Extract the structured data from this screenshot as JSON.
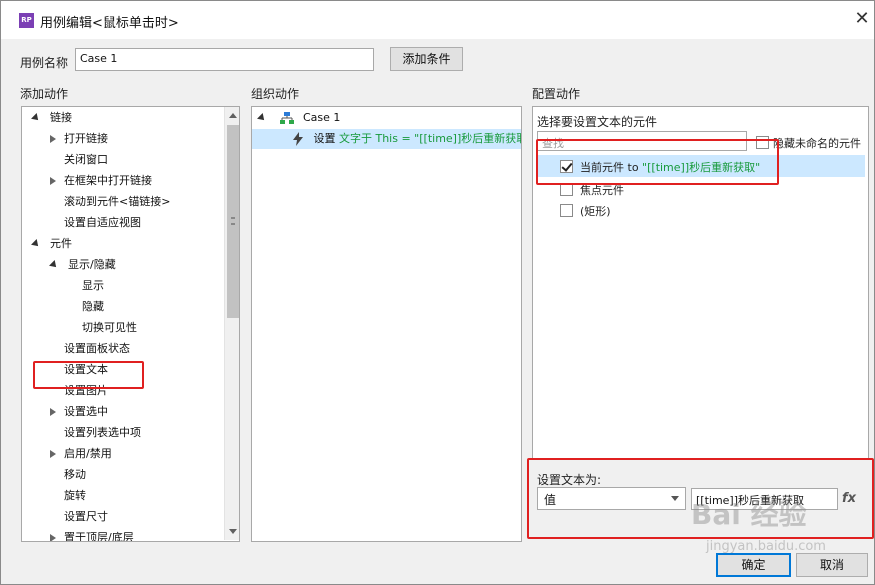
{
  "window": {
    "title": "用例编辑<鼠标单击时>",
    "icon_text": "RP",
    "close_symbol": "✕"
  },
  "case_name": {
    "label": "用例名称",
    "value": "Case 1",
    "add_condition": "添加条件"
  },
  "add_actions": {
    "header": "添加动作",
    "items": [
      {
        "label": "链接",
        "expander": "expanded"
      },
      {
        "label": "打开链接",
        "expander": "collapsed"
      },
      {
        "label": "关闭窗口",
        "expander": "none"
      },
      {
        "label": "在框架中打开链接",
        "expander": "collapsed"
      },
      {
        "label": "滚动到元件<锚链接>",
        "expander": "none"
      },
      {
        "label": "设置自适应视图",
        "expander": "none"
      },
      {
        "label": "元件",
        "expander": "expanded"
      },
      {
        "label": "显示/隐藏",
        "expander": "expanded"
      },
      {
        "label": "显示",
        "expander": "none"
      },
      {
        "label": "隐藏",
        "expander": "none"
      },
      {
        "label": "切换可见性",
        "expander": "none"
      },
      {
        "label": "设置面板状态",
        "expander": "none"
      },
      {
        "label": "设置文本",
        "expander": "none"
      },
      {
        "label": "设置图片",
        "expander": "none"
      },
      {
        "label": "设置选中",
        "expander": "collapsed"
      },
      {
        "label": "设置列表选中项",
        "expander": "none"
      },
      {
        "label": "启用/禁用",
        "expander": "collapsed"
      },
      {
        "label": "移动",
        "expander": "none"
      },
      {
        "label": "旋转",
        "expander": "none"
      },
      {
        "label": "设置尺寸",
        "expander": "none"
      },
      {
        "label": "置于顶层/底层",
        "expander": "collapsed"
      }
    ]
  },
  "organize_actions": {
    "header": "组织动作",
    "case_label": "Case 1",
    "action_prefix": "设置",
    "action_detail": "文字于 This = \"[[time]]秒后重新获取\""
  },
  "configure_actions": {
    "header": "配置动作",
    "select_label": "选择要设置文本的元件",
    "search_placeholder": "查找",
    "hide_unnamed_label": "隐藏未命名的元件",
    "targets": [
      {
        "label": "当前元件",
        "to": "to",
        "value": "\"[[time]]秒后重新获取\"",
        "checked": true
      },
      {
        "label": "焦点元件",
        "checked": false
      },
      {
        "label": "(矩形)",
        "checked": false
      }
    ],
    "set_text_label": "设置文本为:",
    "value_type": "值",
    "text_value": "[[time]]秒后重新获取",
    "fx_label": "fx"
  },
  "buttons": {
    "ok": "确定",
    "cancel": "取消"
  },
  "watermark": {
    "brand": "Bai 经验",
    "url": "jingyan.baidu.com"
  },
  "colors": {
    "highlight": "#e02020",
    "selected_row": "#cce8ff",
    "action_text": "#189a3c"
  }
}
